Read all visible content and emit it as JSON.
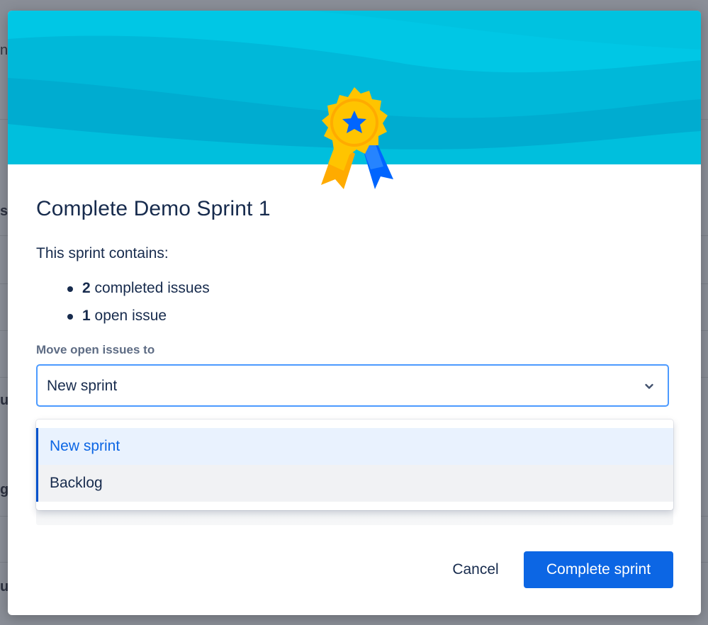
{
  "background_fragments": [
    "n",
    "s",
    "u",
    "g",
    "u"
  ],
  "modal": {
    "title": "Complete Demo Sprint 1",
    "intro": "This sprint contains:",
    "summary": [
      {
        "count": "2",
        "text": " completed issues"
      },
      {
        "count": "1",
        "text": " open issue"
      }
    ],
    "move_label": "Move open issues to",
    "select": {
      "value": "New sprint",
      "options": [
        "New sprint",
        "Backlog"
      ]
    },
    "buttons": {
      "cancel": "Cancel",
      "complete": "Complete sprint"
    }
  },
  "icons": {
    "badge": "award-ribbon-icon",
    "select_chevron": "chevron-down-icon"
  },
  "colors": {
    "header": "#00c7e5",
    "primary": "#0c66e4",
    "focus_border": "#4c9aff",
    "option_selected_bg": "#e9f2fe",
    "badge_gold": "#ffc400",
    "badge_blue": "#0065ff"
  }
}
